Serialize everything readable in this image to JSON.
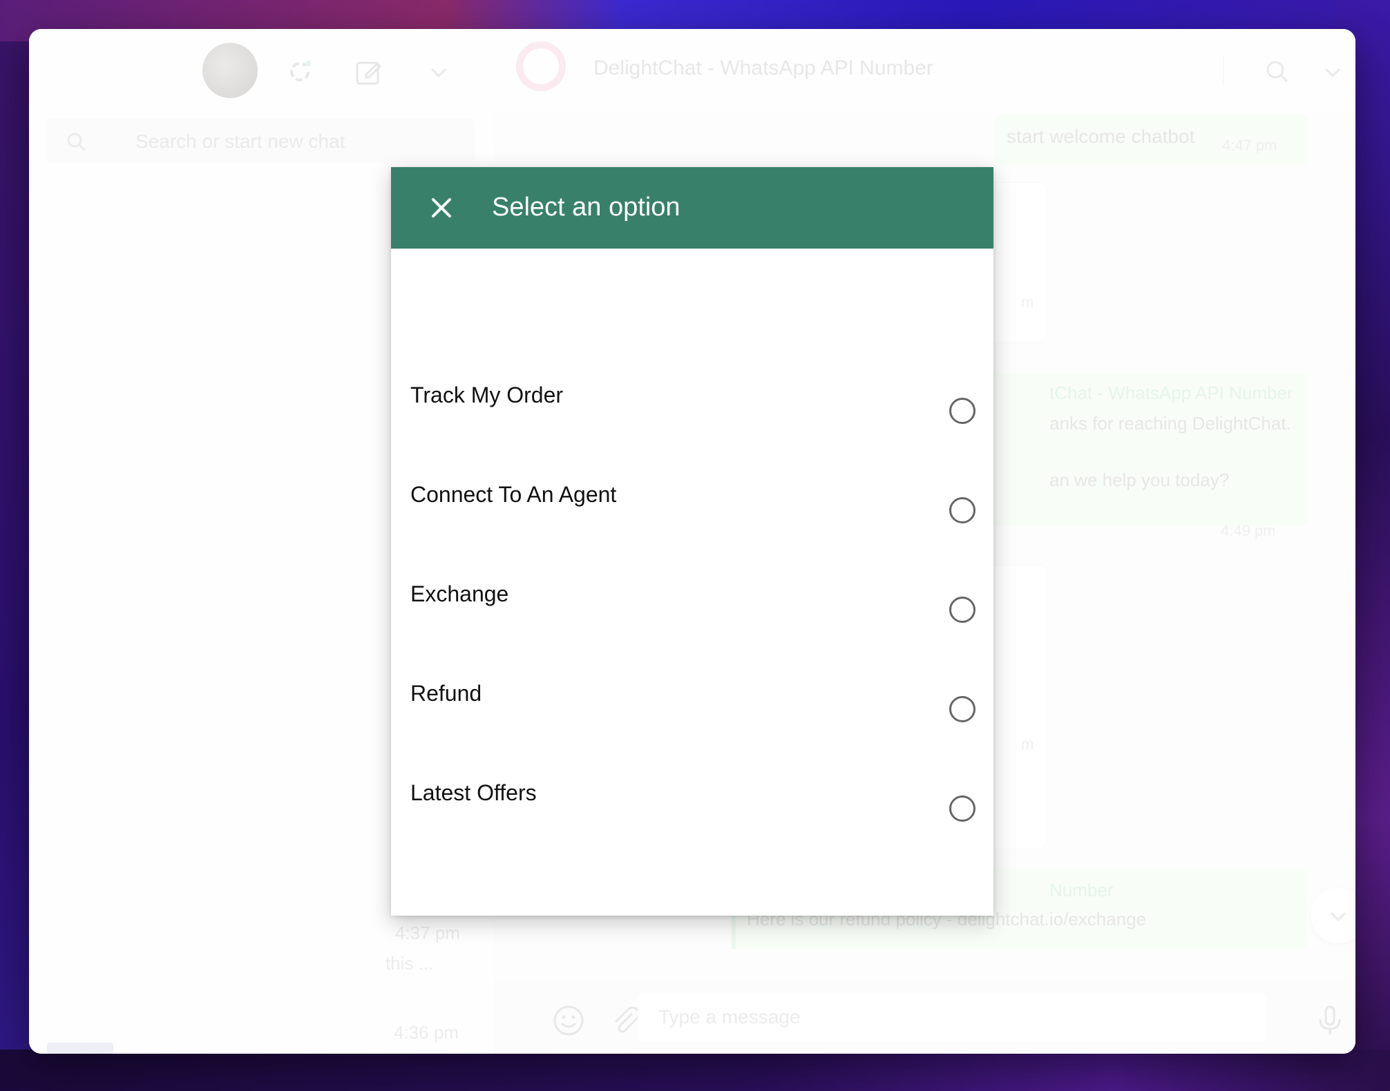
{
  "left_panel": {
    "search_placeholder": "Search or start new chat",
    "chat_list_fragments": [
      {
        "time": "4:37 pm",
        "preview": "this ..."
      },
      {
        "time": "4:36 pm",
        "preview": ""
      }
    ]
  },
  "chat": {
    "title": "DelightChat - WhatsApp API Number",
    "messages": [
      {
        "type": "outgoing",
        "text": "start welcome chatbot",
        "time": "4:47 pm"
      },
      {
        "type": "incoming-fragment",
        "time_fragment": "m"
      },
      {
        "type": "outgoing-quoted",
        "sender_fragment": "tChat - WhatsApp API Number",
        "line1_fragment": "anks for reaching DelightChat.",
        "line2_fragment": "an we help you today?",
        "time": "4:49 pm"
      },
      {
        "type": "incoming-fragment",
        "time_fragment": "m"
      },
      {
        "type": "outgoing-quoted",
        "sender_fragment": "Number",
        "text": "Here is our refund policy - delightchat.io/exchange"
      }
    ],
    "composer_placeholder": "Type a message"
  },
  "modal": {
    "title": "Select an option",
    "options": [
      {
        "label": "Track My Order",
        "selected": false
      },
      {
        "label": "Connect To An Agent",
        "selected": false
      },
      {
        "label": "Exchange",
        "selected": false
      },
      {
        "label": "Refund",
        "selected": false
      },
      {
        "label": "Latest Offers",
        "selected": false
      }
    ]
  },
  "colors": {
    "modal_header": "#38806a",
    "outgoing_bubble": "#f3fbef",
    "logo_ring": "#f6d5de"
  },
  "icons": {
    "close": "close-icon",
    "refresh": "refresh-icon",
    "compose": "compose-icon",
    "chevron": "chevron-down-icon",
    "search": "search-icon",
    "emoji": "emoji-icon",
    "attach": "attach-icon",
    "mic": "microphone-icon"
  }
}
